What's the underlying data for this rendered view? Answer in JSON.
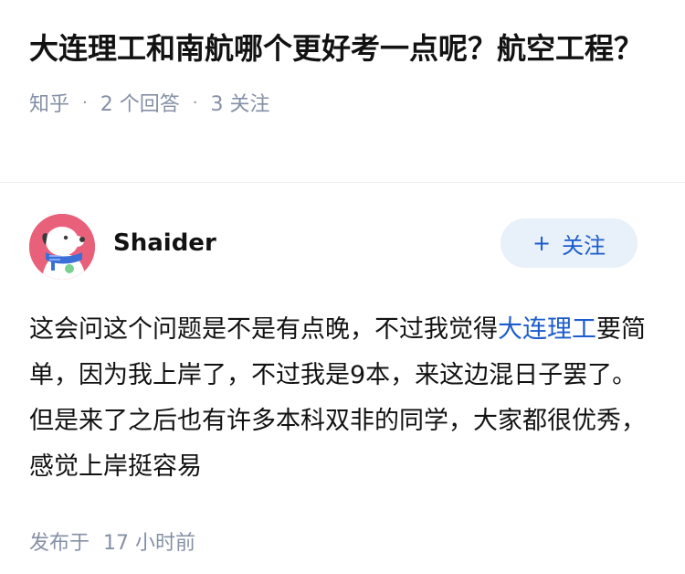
{
  "question": {
    "title": "大连理工和南航哪个更好考一点呢？航空工程？",
    "source": "知乎",
    "answer_count": "2 个回答",
    "follow_count": "3 关注"
  },
  "answer": {
    "author_name": "Shaider",
    "follow_label": "关注",
    "content_before_link": "这会问这个问题是不是有点晚，不过我觉得",
    "content_link": "大连理工",
    "content_after_link": "要简单，因为我上岸了，不过我是9本，来这边混日子罢了。但是来了之后也有许多本科双非的同学，大家都很优秀，感觉上岸挺容易",
    "publish_label": "发布于",
    "publish_time": "17 小时前"
  },
  "colors": {
    "link": "#1c5ccc",
    "meta": "#8590a6",
    "follow_bg": "#e8f0fa",
    "avatar_bg": "#e8607a"
  },
  "icons": {
    "avatar": "cartoon-dog-avatar",
    "follow_plus": "plus-icon"
  }
}
